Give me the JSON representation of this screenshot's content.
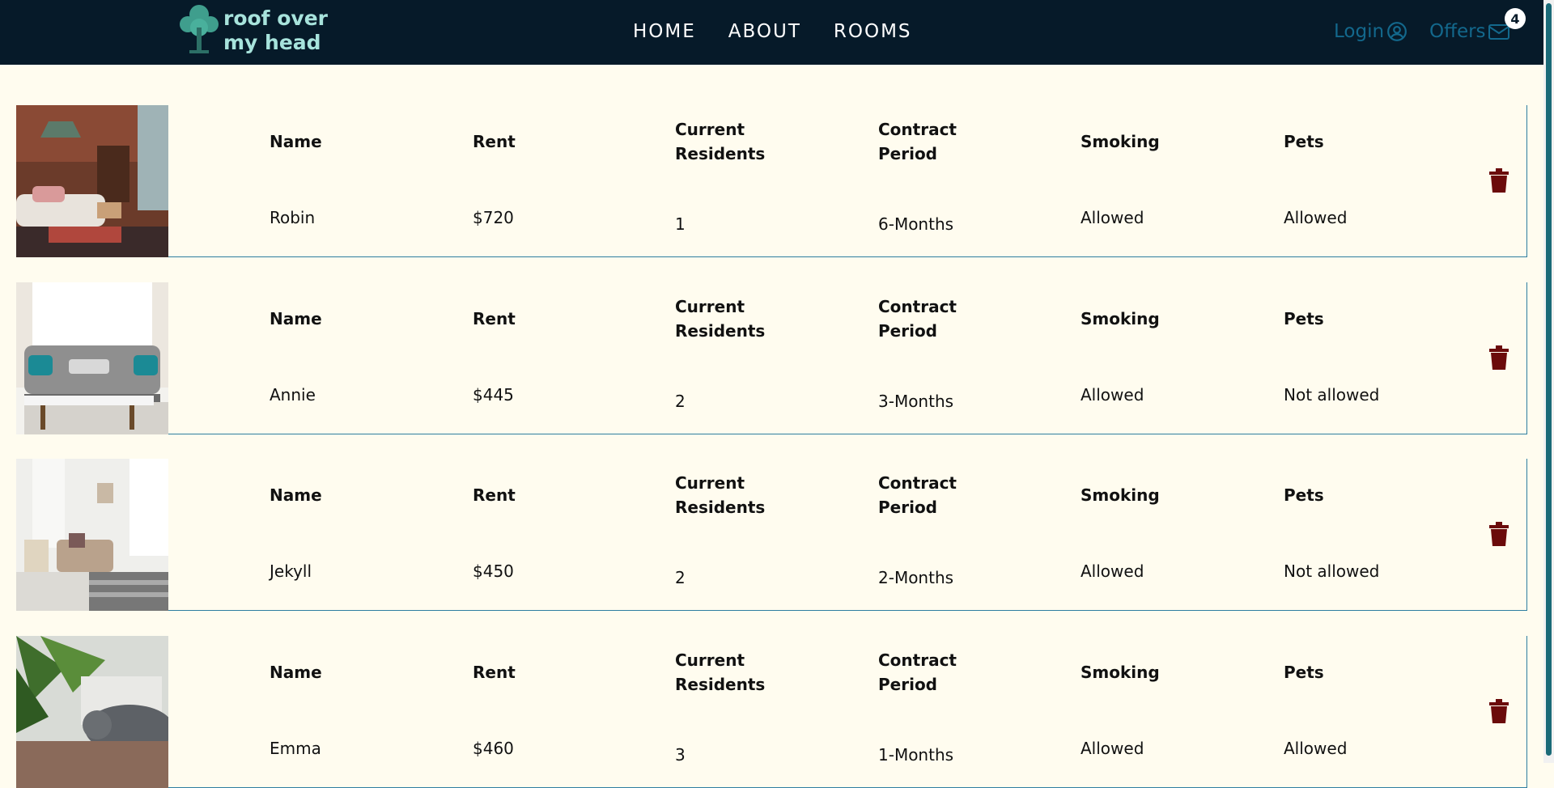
{
  "brand": {
    "logo_text_line1": "roof over",
    "logo_text_line2": "my head",
    "primary_color": "#061a29",
    "accent_color": "#13688c",
    "background_color": "#fffcef",
    "delete_color": "#6b0b0b"
  },
  "nav": {
    "home": "HOME",
    "about": "ABOUT",
    "rooms": "ROOMS",
    "login_label": "Login",
    "login_icon": "user-circle-icon",
    "offers_label": "Offers",
    "offers_icon": "envelope-icon",
    "offers_count": "4"
  },
  "labels": {
    "name": "Name",
    "rent": "Rent",
    "residents_1": "Current",
    "residents_2": "Residents",
    "period_1": "Contract",
    "period_2": "Period",
    "smoking": "Smoking",
    "pets": "Pets"
  },
  "listings": [
    {
      "name": "Robin",
      "rent": "$720",
      "residents": "1",
      "period": "6-Months",
      "smoking": "Allowed",
      "pets": "Allowed",
      "image": "loft-living-room-photo"
    },
    {
      "name": "Annie",
      "rent": "$445",
      "residents": "2",
      "period": "3-Months",
      "smoking": "Allowed",
      "pets": "Not allowed",
      "image": "grey-sofa-photo"
    },
    {
      "name": "Jekyll",
      "rent": "$450",
      "residents": "2",
      "period": "2-Months",
      "smoking": "Allowed",
      "pets": "Not allowed",
      "image": "white-bedroom-photo"
    },
    {
      "name": "Emma",
      "rent": "$460",
      "residents": "3",
      "period": "1-Months",
      "smoking": "Allowed",
      "pets": "Allowed",
      "image": "cat-plant-photo"
    }
  ]
}
